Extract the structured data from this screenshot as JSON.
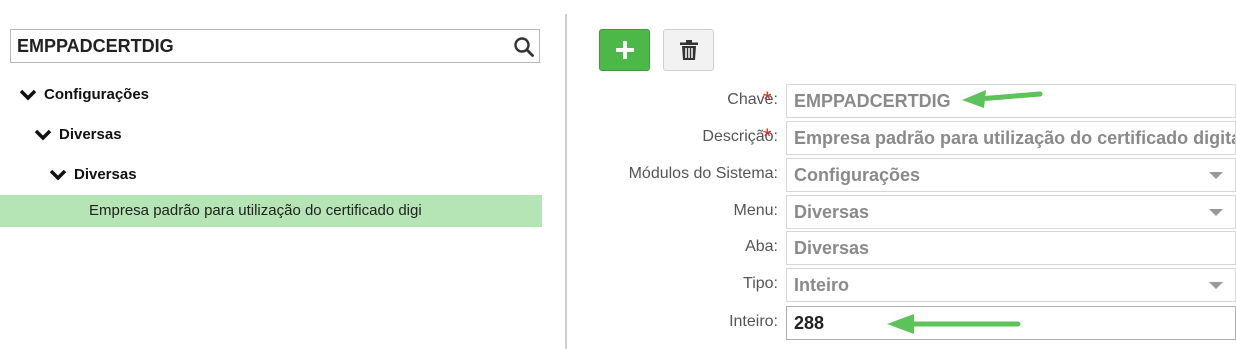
{
  "search": {
    "value": "EMPPADCERTDIG"
  },
  "tree": {
    "level1": "Configurações",
    "level2": "Diversas",
    "level3": "Diversas",
    "selected_leaf": "Empresa padrão para utilização do certificado digi"
  },
  "form": {
    "chave": {
      "label": "Chave:",
      "value": "EMPPADCERTDIG",
      "required": "*"
    },
    "descricao": {
      "label": "Descrição:",
      "value": "Empresa padrão para utilização do certificado digital",
      "required": "*"
    },
    "modulos": {
      "label": "Módulos do Sistema:",
      "value": "Configurações"
    },
    "menu": {
      "label": "Menu:",
      "value": "Diversas"
    },
    "aba": {
      "label": "Aba:",
      "value": "Diversas"
    },
    "tipo": {
      "label": "Tipo:",
      "value": "Inteiro"
    },
    "inteiro": {
      "label": "Inteiro:",
      "value": "288"
    }
  },
  "colors": {
    "add_button": "#4cb848",
    "selected_row": "#b5e4b5",
    "annotation_arrow": "#5cc35a",
    "required_star": "#d9342b"
  }
}
